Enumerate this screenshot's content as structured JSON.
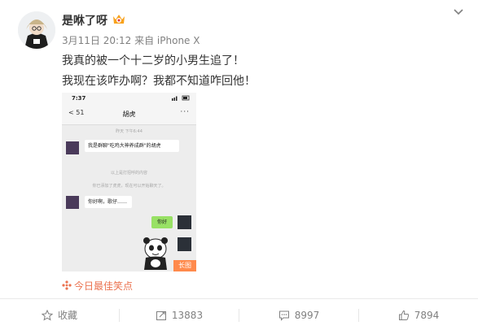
{
  "post": {
    "username": "是咻了呀",
    "meta": "3月11日 20:12 来自 iPhone X",
    "lines": [
      "我真的被一个十二岁的小男生追了！",
      "我现在该咋办啊？我都不知道咋回他！"
    ],
    "source": "今日最佳笑点"
  },
  "screenshot": {
    "time": "7:37",
    "nav_back": "< 51",
    "nav_title": "胡虎",
    "nav_more": "···",
    "sys_time": "昨天 下午6:44",
    "msg1": "我是群聊\"吃鸡大神养成群\"的胡虎",
    "sys_history": "以上是打招呼的内容",
    "sys_added": "你已添加了虎虎，现在可以开始聊天了。",
    "msg2": "你好啊，歌仔……",
    "msg3": "你好",
    "long_badge": "长图"
  },
  "actions": {
    "favorite": "收藏",
    "repost": "13883",
    "comment": "8997",
    "like": "7894"
  },
  "colors": {
    "link": "#eb7350",
    "muted": "#808080",
    "chat_bg": "#ededed",
    "my_bubble": "#98e165",
    "badge": "#ff8a4c"
  }
}
